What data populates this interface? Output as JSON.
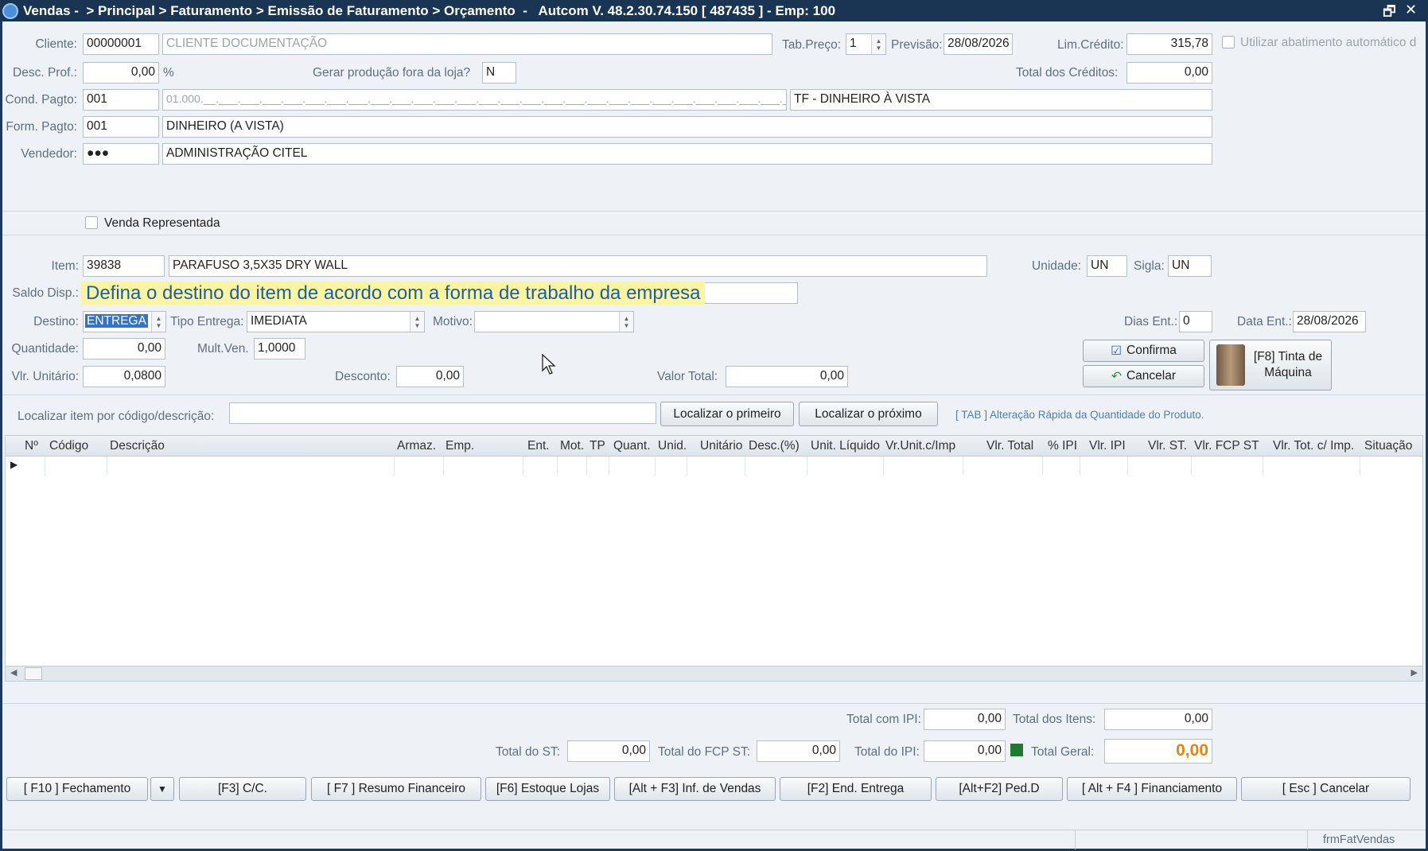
{
  "window": {
    "title": "Vendas -  > Principal > Faturamento > Emissão de Faturamento > Orçamento  -   Autcom V. 48.2.30.74.150 [ 487435 ] - Emp: 100",
    "restore_icon": "restore-icon",
    "close_icon": "close-icon"
  },
  "header": {
    "cliente_label": "Cliente:",
    "cliente_code": "00000001",
    "cliente_name": "CLIENTE DOCUMENTAÇÃO",
    "tab_preco_label": "Tab.Preço:",
    "tab_preco": "1",
    "previsao_label": "Previsão:",
    "previsao": "28/08/2026",
    "lim_credito_label": "Lim.Crédito:",
    "lim_credito": "315,78",
    "abatimento_label": "Utilizar abatimento automático d",
    "desc_prof_label": "Desc. Prof.:",
    "desc_prof": "0,00",
    "percent": "%",
    "gerar_producao_label": "Gerar produção fora da loja?",
    "gerar_producao": "N",
    "total_creditos_label": "Total dos Créditos:",
    "total_creditos": "0,00",
    "cond_pagto_label": "Cond. Pagto:",
    "cond_pagto": "001",
    "cond_pagto_mask": "01.000.__.___.___.___.___.___.___.___.___.___.___.___.___.___.___.___.___.___.___.___.___.___.___.___.___.___.___.___",
    "cond_pagto_desc": "TF - DINHEIRO À VISTA",
    "form_pagto_label": "Form. Pagto:",
    "form_pagto": "001",
    "form_pagto_desc": "DINHEIRO (A VISTA)",
    "vendedor_label": "Vendedor:",
    "vendedor": "●●●",
    "vendedor_desc": "ADMINISTRAÇÃO CITEL",
    "venda_representada_label": "Venda Representada"
  },
  "item": {
    "item_label": "Item:",
    "item_code": "39838",
    "item_desc": "PARAFUSO 3,5X35 DRY WALL",
    "unidade_label": "Unidade:",
    "unidade": "UN",
    "sigla_label": "Sigla:",
    "sigla": "UN",
    "saldo_label": "Saldo Disp.:",
    "tooltip": "Defina o destino do item de acordo com a forma de trabalho da empresa",
    "destino_label": "Destino:",
    "destino": "ENTREGA",
    "tipo_entrega_label": "Tipo Entrega:",
    "tipo_entrega": "IMEDIATA",
    "motivo_label": "Motivo:",
    "motivo": "",
    "dias_ent_label": "Dias Ent.:",
    "dias_ent": "0",
    "data_ent_label": "Data Ent.:",
    "data_ent": "28/08/2026",
    "quantidade_label": "Quantidade:",
    "quantidade": "0,00",
    "mult_ven_label": "Mult.Ven.",
    "mult_ven": "1,0000",
    "vlr_unitario_label": "Vlr. Unitário:",
    "vlr_unitario": "0,0800",
    "desconto_label": "Desconto:",
    "desconto": "0,00",
    "valor_total_label": "Valor Total:",
    "valor_total": "0,00",
    "confirma": "Confirma",
    "cancelar": "Cancelar",
    "tinta": "[F8] Tinta de Máquina"
  },
  "search": {
    "label": "Localizar item por código/descrição:",
    "value": "",
    "primeiro": "Localizar o primeiro",
    "proximo": "Localizar o próximo",
    "hint": "[ TAB ] Alteração Rápida da Quantidade do Produto."
  },
  "grid": {
    "columns": [
      "Nº",
      "Código",
      "Descrição",
      "Armaz.",
      "Emp.",
      "Ent.",
      "Mot.",
      "TP",
      "Quant.",
      "Unid.",
      "Unitário",
      "Desc.(%)",
      "Unit. Líquido",
      "Vr.Unit.c/Imp",
      "Vlr. Total",
      "% IPI",
      "Vlr. IPI",
      "Vlr. ST.",
      "Vlr. FCP ST",
      "Vlr. Tot. c/ Imp.",
      "Situação"
    ]
  },
  "totals": {
    "total_ipi_label": "Total com IPI:",
    "total_ipi": "0,00",
    "total_itens_label": "Total dos Itens:",
    "total_itens": "0,00",
    "total_st_label": "Total do ST:",
    "total_st": "0,00",
    "total_fcp_label": "Total do FCP ST:",
    "total_fcp": "0,00",
    "total_do_ipi_label": "Total do IPI:",
    "total_do_ipi": "0,00",
    "total_geral_label": "Total Geral:",
    "total_geral": "0,00",
    "total_geral_color": "#e8820c"
  },
  "footer": {
    "buttons": [
      "[ F10 ] Fechamento",
      "[F3] C/C.",
      "[ F7 ] Resumo Financeiro",
      "[F6] Estoque Lojas",
      "[Alt + F3] Inf. de Vendas",
      "[F2] End. Entrega",
      "[Alt+F2] Ped.D",
      "[ Alt + F4 ] Financiamento",
      "[ Esc ] Cancelar"
    ],
    "status_form": "frmFatVendas"
  }
}
